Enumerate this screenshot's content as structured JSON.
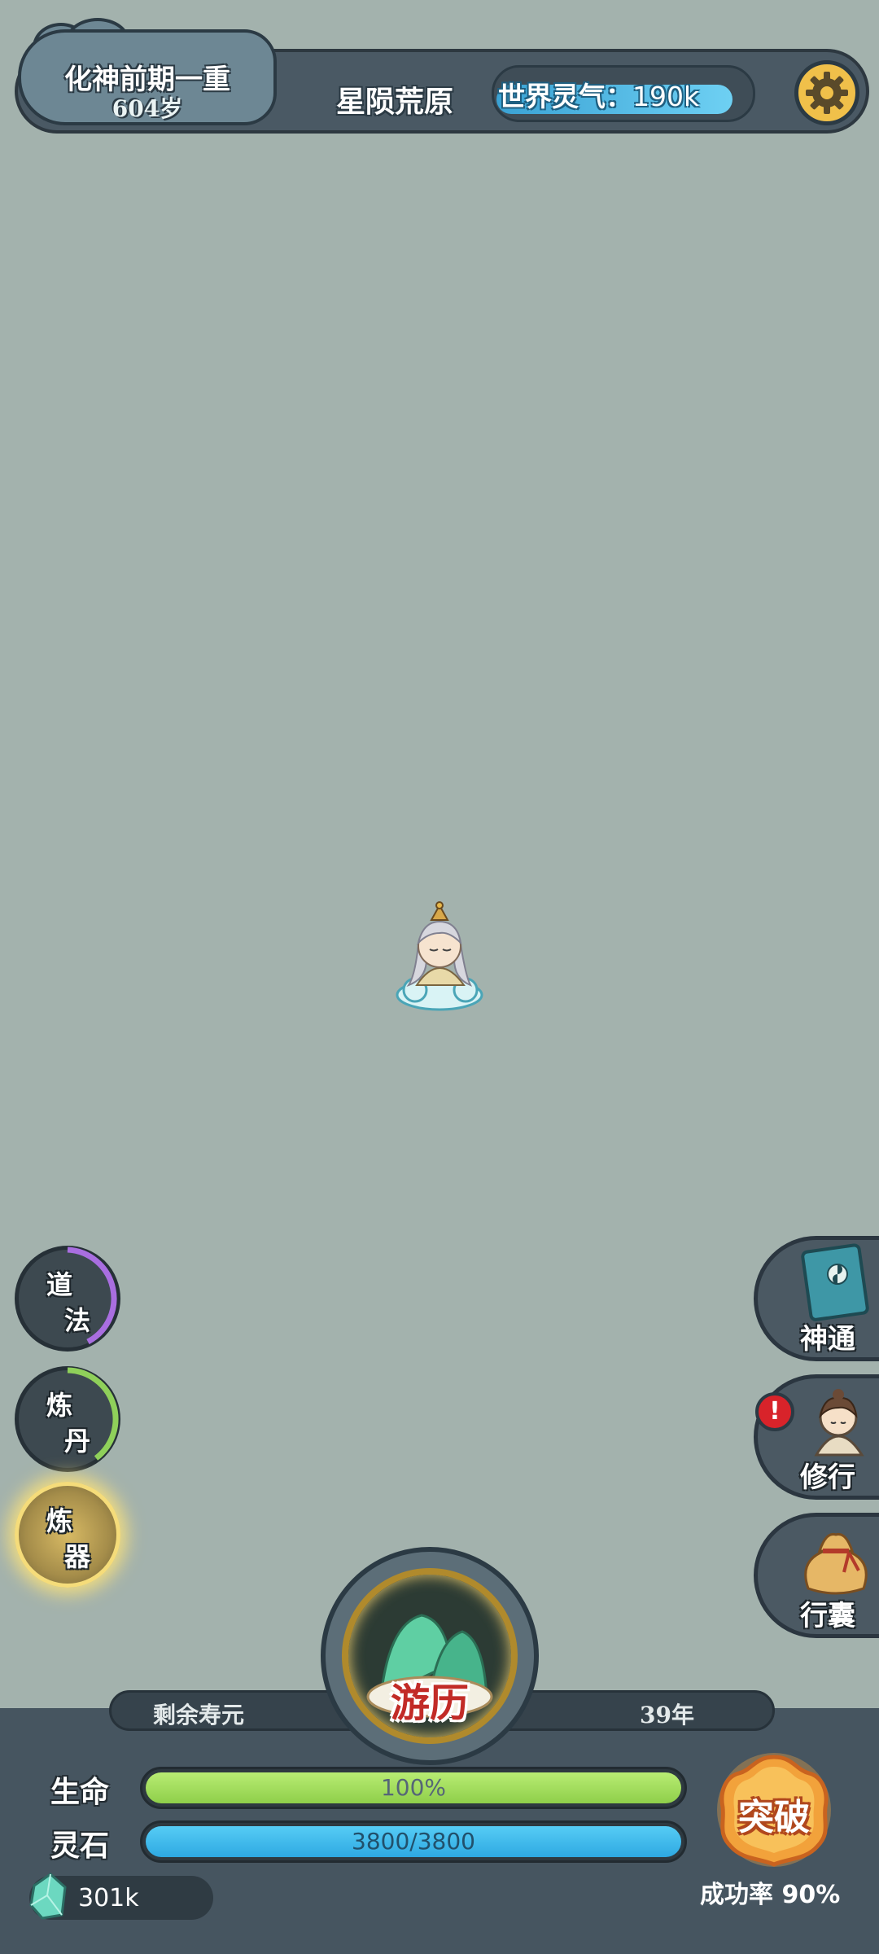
{
  "header": {
    "realm": "化神前期一重",
    "age": "604岁",
    "location": "星陨荒原",
    "world_qi_label": "世界灵气：",
    "world_qi_value": "190k"
  },
  "left_menu": [
    {
      "line1": "道",
      "line2": "法",
      "progress_color": "#a96ee0"
    },
    {
      "line1": "炼",
      "line2": "丹",
      "progress_color": "#8fd05a"
    },
    {
      "line1": "炼",
      "line2": "器",
      "highlighted": true
    }
  ],
  "right_menu": [
    {
      "label": "神通",
      "icon": "book-icon"
    },
    {
      "label": "修行",
      "icon": "disciple-icon",
      "alert": "!"
    },
    {
      "label": "行囊",
      "icon": "bag-icon"
    }
  ],
  "travel_button": {
    "label": "游历"
  },
  "lifespan": {
    "label": "剩余寿元",
    "value": "39年"
  },
  "stats": {
    "hp_label": "生命",
    "hp_text": "100%",
    "hp_fraction": 1.0,
    "stone_label": "灵石",
    "stone_text": "3800/3800",
    "stone_fraction": 1.0
  },
  "currency": {
    "value": "301k",
    "icon": "jade-gem-icon"
  },
  "breakthrough": {
    "label": "突破",
    "success_rate": "成功率 90%"
  },
  "colors": {
    "background": "#a3b2ad",
    "hp": "#9bdc58",
    "spirit_stone": "#3bb8ec",
    "accent_gold": "#f0c04a"
  }
}
